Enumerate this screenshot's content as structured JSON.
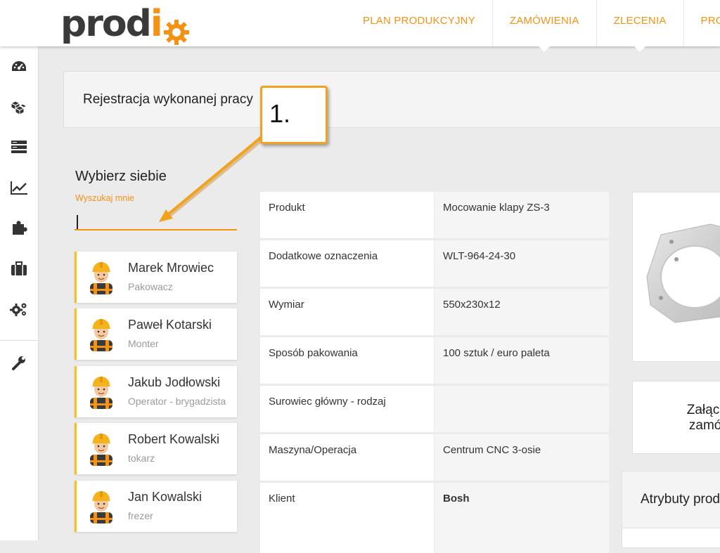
{
  "brand": {
    "logo_dark": "prod",
    "logo_accent": "i",
    "colors": {
      "accent": "#f39214",
      "worker_bar": "#f5c11a"
    }
  },
  "nav": {
    "items": [
      "PLAN PRODUKCYJNY",
      "ZAMÓWIENIA",
      "ZLECENIA",
      "PRO"
    ]
  },
  "sidebar": {
    "icons": [
      "dashboard-icon",
      "boxes-icon",
      "server-icon",
      "chart-line-icon",
      "puzzle-icon",
      "briefcase-icon",
      "gears-icon",
      "wrench-icon"
    ]
  },
  "header": {
    "title": "Rejestracja wykonanej pracy"
  },
  "workers_section": {
    "title": "Wybierz siebie",
    "search_label": "Wyszukaj mnie",
    "search_value": "",
    "workers": [
      {
        "name": "Marek Mrowiec",
        "role": "Pakowacz"
      },
      {
        "name": "Paweł Kotarski",
        "role": "Monter"
      },
      {
        "name": "Jakub Jodłowski",
        "role": "Operator - brygadzista"
      },
      {
        "name": "Robert Kowalski",
        "role": "tokarz"
      },
      {
        "name": "Jan Kowalski",
        "role": "frezer"
      }
    ]
  },
  "product_table": {
    "rows": [
      {
        "label": "Produkt",
        "value": "Mocowanie klapy ZS-3"
      },
      {
        "label": "Dodatkowe oznaczenia",
        "value": "WLT-964-24-30"
      },
      {
        "label": "Wymiar",
        "value": "550x230x12"
      },
      {
        "label": "Sposób pakowania",
        "value": "100 sztuk / euro paleta"
      },
      {
        "label": "Surowiec główny - rodzaj",
        "value": ""
      },
      {
        "label": "Maszyna/Operacja",
        "value": "Centrum CNC 3-osie"
      },
      {
        "label": "Klient",
        "value": "Bosh"
      }
    ]
  },
  "attachments": {
    "line1": "Załączn",
    "line2": "zamów"
  },
  "attributes": {
    "title": "Atrybuty prod"
  },
  "annotation": {
    "label": "1."
  }
}
